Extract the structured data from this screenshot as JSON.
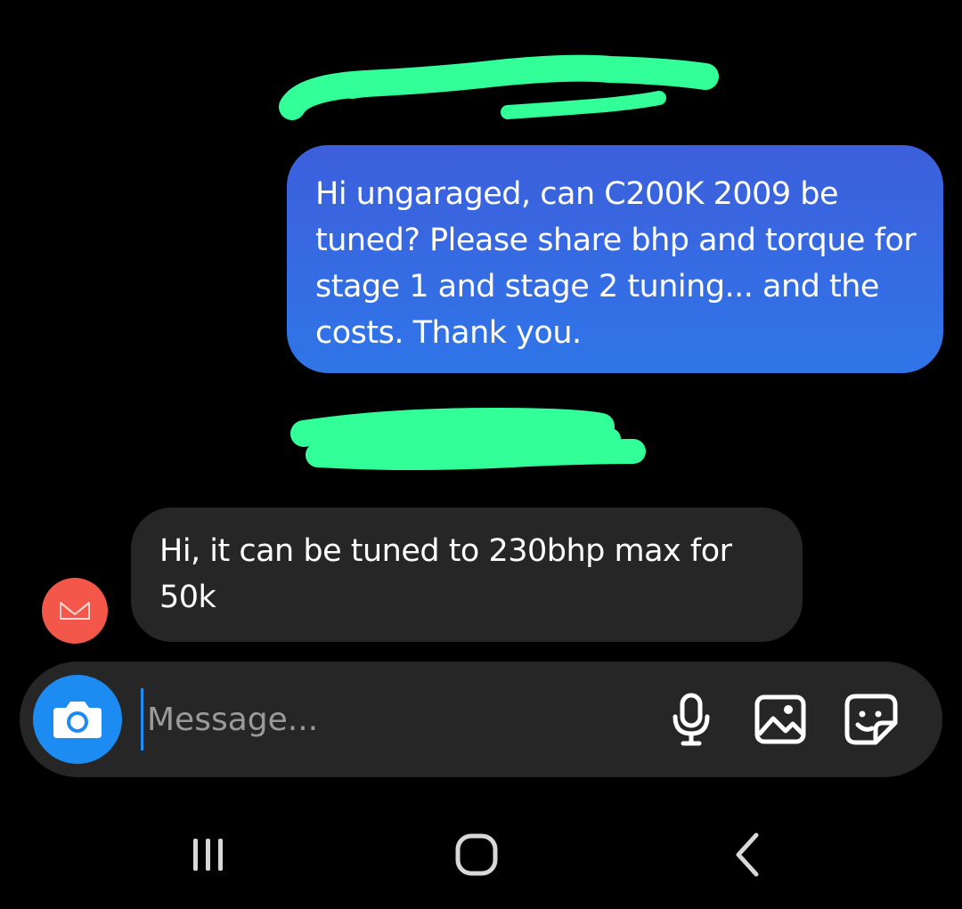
{
  "thread": {
    "sent_message": "Hi ungaraged, can C200K 2009 be tuned? Please share bhp and torque for stage 1 and stage 2 tuning... and the costs. Thank you.",
    "received_message": "Hi, it can be tuned to 230bhp max for 50k",
    "redaction_color": "#33ff99"
  },
  "composer": {
    "placeholder": "Message...",
    "camera_icon": "camera-icon",
    "mic_icon": "microphone-icon",
    "gallery_icon": "gallery-icon",
    "sticker_icon": "sticker-icon"
  },
  "nav_bar": {
    "recents_icon": "recents-icon",
    "home_icon": "home-icon",
    "back_icon": "back-icon"
  },
  "colors": {
    "sent_bubble_top": "#3d5fdc",
    "sent_bubble_bottom": "#2f75e8",
    "received_bubble": "#262626",
    "avatar": "#f2574a",
    "camera_button": "#1d8cf2"
  }
}
